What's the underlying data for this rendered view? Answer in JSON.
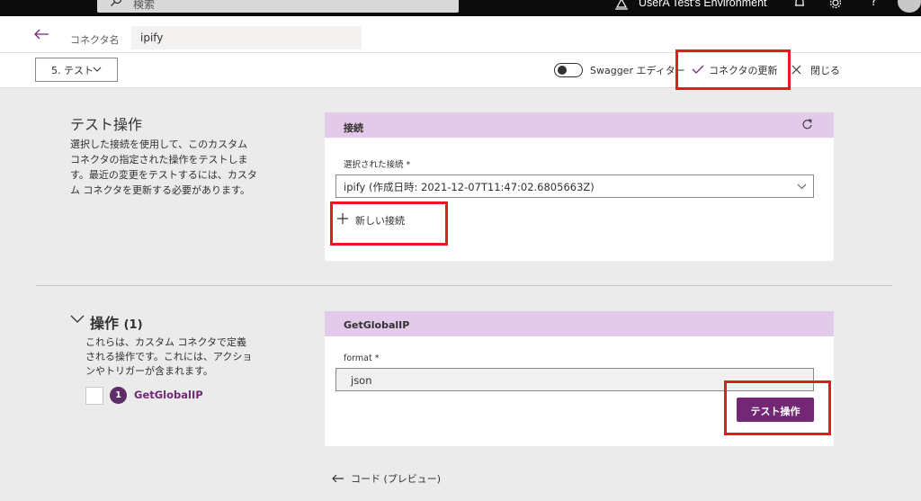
{
  "topbar": {
    "search_placeholder": "検索",
    "environment": "UserA Test's Environment",
    "help": "?"
  },
  "header": {
    "name_label": "コネクタ名",
    "name_value": "ipify"
  },
  "toolbar": {
    "step_label": "5. テスト",
    "swagger_label": "Swagger エディター",
    "update_label": "コネクタの更新",
    "close_label": "閉じる"
  },
  "test_section": {
    "title": "テスト操作",
    "description": "選択した接続を使用して、このカスタム コネクタの指定された操作をテストします。最近の変更をテストするには、カスタム コネクタを更新する必要があります。"
  },
  "connection_card": {
    "title": "接続",
    "field_label": "選択された接続 *",
    "selected_value": "ipify (作成日時: 2021-12-07T11:47:02.6805663Z)",
    "new_connection_label": "新しい接続"
  },
  "operations_section": {
    "title": "操作",
    "count": "(1)",
    "description": "これらは、カスタム コネクタで定義される操作です。これには、アクションやトリガーが含まれます。",
    "operation_number": "1",
    "operation_name": "GetGlobalIP"
  },
  "operation_card": {
    "title": "GetGlobalIP",
    "format_label": "format *",
    "format_value": "json",
    "test_button_label": "テスト操作"
  },
  "footer": {
    "code_preview_label": "コード (プレビュー)"
  },
  "colors": {
    "accent": "#742774",
    "card_header": "#e3c9ea",
    "highlight": "#e31b23",
    "background": "#ebebeb"
  }
}
